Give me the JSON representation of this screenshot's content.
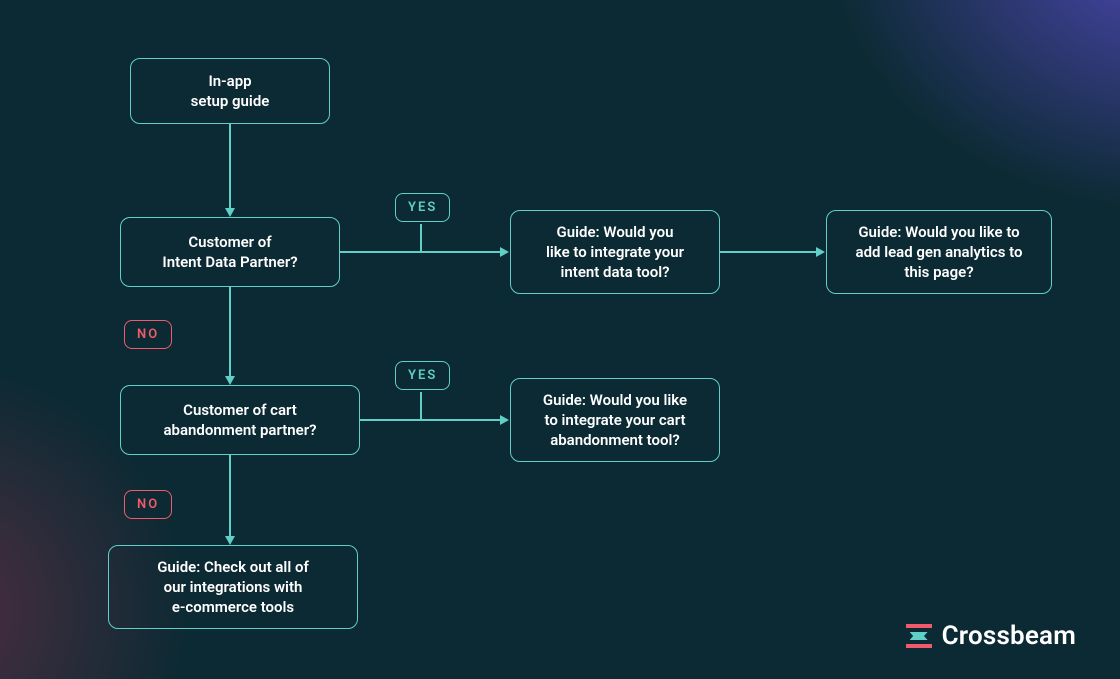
{
  "nodes": {
    "start": "In-app\nsetup guide",
    "q_intent": "Customer of\nIntent Data Partner?",
    "g_intent": "Guide: Would you\nlike to integrate your\nintent data tool?",
    "g_leadgen": "Guide: Would you like to\nadd lead gen analytics to\nthis page?",
    "q_cart": "Customer of cart\nabandonment partner?",
    "g_cart": "Guide: Would you like\nto integrate your cart\nabandonment tool?",
    "g_all": "Guide: Check out all of\nour integrations with\ne-commerce tools"
  },
  "labels": {
    "yes": "YES",
    "no": "NO"
  },
  "brand": "Crossbeam"
}
